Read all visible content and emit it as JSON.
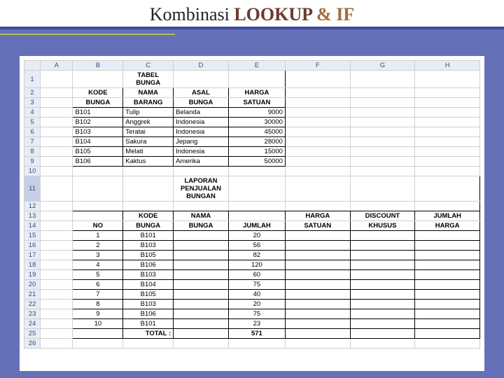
{
  "title": {
    "part1": "Kombinasi ",
    "part2": "LOOKUP ",
    "part3": "& IF"
  },
  "cols": [
    "A",
    "B",
    "C",
    "D",
    "E",
    "F",
    "G",
    "H"
  ],
  "rows": [
    "1",
    "2",
    "3",
    "4",
    "5",
    "6",
    "7",
    "8",
    "9",
    "10",
    "11",
    "12",
    "13",
    "14",
    "15",
    "16",
    "17",
    "18",
    "19",
    "20",
    "21",
    "22",
    "23",
    "24",
    "25",
    "26"
  ],
  "table1": {
    "title": "TABEL BUNGA",
    "headers": {
      "0a": "KODE",
      "0b": "BUNGA",
      "1a": "NAMA",
      "1b": "BARANG",
      "2a": "ASAL",
      "2b": "BUNGA",
      "3a": "HARGA",
      "3b": "SATUAN"
    },
    "data": [
      [
        "B101",
        "Tulip",
        "Belanda",
        "9000"
      ],
      [
        "B102",
        "Anggrek",
        "Indonesia",
        "30000"
      ],
      [
        "B103",
        "Teratai",
        "Indonesia",
        "45000"
      ],
      [
        "B104",
        "Sakura",
        "Jepang",
        "28000"
      ],
      [
        "B105",
        "Melati",
        "Indonesia",
        "15000"
      ],
      [
        "B106",
        "Kaktus",
        "Amerika",
        "50000"
      ]
    ]
  },
  "table2": {
    "title": "LAPORAN PENJUALAN BUNGAN",
    "headers": {
      "0b": "NO",
      "1a": "KODE",
      "1b": "BUNGA",
      "2a": "NAMA",
      "2b": "BUNGA",
      "3b": "JUMLAH",
      "4a": "HARGA",
      "4b": "SATUAN",
      "5a": "DISCOUNT",
      "5b": "KHUSUS",
      "6a": "JUMLAH",
      "6b": "HARGA"
    },
    "data": [
      [
        "1",
        "B101",
        "",
        "20"
      ],
      [
        "2",
        "B103",
        "",
        "56"
      ],
      [
        "3",
        "B105",
        "",
        "82"
      ],
      [
        "4",
        "B106",
        "",
        "120"
      ],
      [
        "5",
        "B103",
        "",
        "60"
      ],
      [
        "6",
        "B104",
        "",
        "75"
      ],
      [
        "7",
        "B105",
        "",
        "40"
      ],
      [
        "8",
        "B103",
        "",
        "20"
      ],
      [
        "9",
        "B106",
        "",
        "75"
      ],
      [
        "10",
        "B101",
        "",
        "23"
      ]
    ],
    "total_label": "TOTAL :",
    "total_value": "571"
  }
}
